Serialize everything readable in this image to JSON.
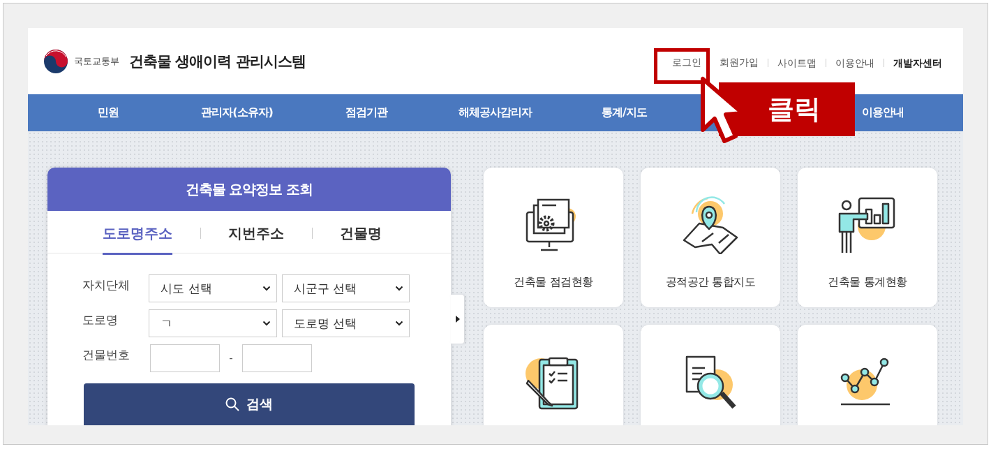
{
  "header": {
    "ministry": "국토교통부",
    "title": "건축물 생애이력 관리시스템",
    "top_links": [
      {
        "label": "로그인",
        "bold": false
      },
      {
        "label": "회원가입",
        "bold": false
      },
      {
        "label": "사이트맵",
        "bold": false
      },
      {
        "label": "이용안내",
        "bold": false
      },
      {
        "label": "개발자센터",
        "bold": true
      }
    ]
  },
  "nav": {
    "items": [
      "민원",
      "관리자(소유자)",
      "점검기관",
      "해체공사감리자",
      "통계/지도",
      "이용안내"
    ]
  },
  "annotation": {
    "label": "클릭"
  },
  "search_panel": {
    "title": "건축물 요약정보 조회",
    "tabs": [
      {
        "label": "도로명주소",
        "selected": true
      },
      {
        "label": "지번주소",
        "selected": false
      },
      {
        "label": "건물명",
        "selected": false
      }
    ],
    "fields": [
      {
        "label": "자치단체",
        "kind": "select-pair",
        "values": [
          "시도 선택",
          "시군구 선택"
        ]
      },
      {
        "label": "도로명",
        "kind": "select-pair",
        "values": [
          "ㄱ",
          "도로명 선택"
        ]
      },
      {
        "label": "건물번호",
        "kind": "input-pair",
        "separator": "-"
      }
    ],
    "search_button": "검색"
  },
  "tiles": [
    {
      "kind": "monitor",
      "label": "건축물 점검현황"
    },
    {
      "kind": "map",
      "label": "공적공간 통합지도"
    },
    {
      "kind": "presenter",
      "label": "건축물 통계현황"
    },
    {
      "kind": "clipboard"
    },
    {
      "kind": "document"
    },
    {
      "kind": "graph"
    }
  ]
}
